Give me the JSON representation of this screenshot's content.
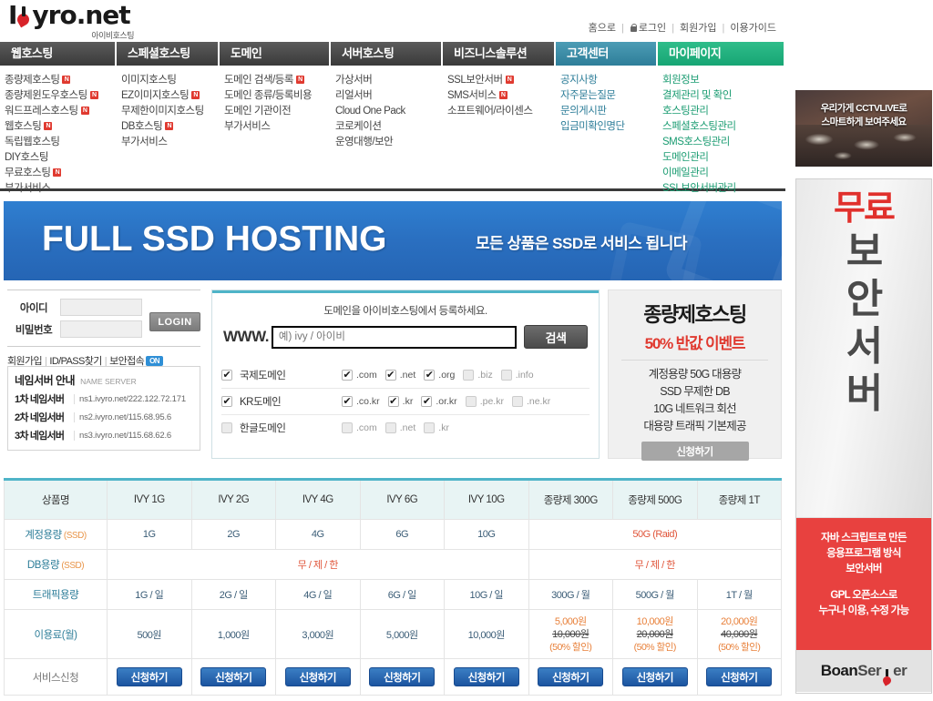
{
  "site": {
    "logo_text": "I",
    "logo_text2": "yro.net",
    "logo_sub": "아이비호스팅"
  },
  "top_links": [
    {
      "label": "홈으로",
      "icon": ""
    },
    {
      "label": "로그인",
      "icon": "lock-icon"
    },
    {
      "label": "회원가입",
      "icon": ""
    },
    {
      "label": "이용가이드",
      "icon": ""
    }
  ],
  "nav": {
    "tabs": [
      {
        "label": "웹호스팅",
        "style": "dark",
        "width": 128
      },
      {
        "label": "스페셜호스팅",
        "style": "dark",
        "width": 113
      },
      {
        "label": "도메인",
        "style": "dark",
        "width": 122
      },
      {
        "label": "서버호스팅",
        "style": "dark",
        "width": 123
      },
      {
        "label": "비즈니스솔루션",
        "style": "dark",
        "width": 124
      },
      {
        "label": "고객센터",
        "style": "cyan",
        "width": 112
      },
      {
        "label": "마이페이지",
        "style": "green",
        "width": 138
      }
    ]
  },
  "mega": {
    "columns": [
      {
        "style": "dark",
        "width": 128,
        "items": [
          {
            "label": "종량제호스팅",
            "new": true
          },
          {
            "label": "종량제윈도우호스팅",
            "new": true
          },
          {
            "label": "워드프레스호스팅",
            "new": true
          },
          {
            "label": "웹호스팅",
            "new": true
          },
          {
            "label": "독립웹호스팅",
            "new": false
          },
          {
            "label": "DIY호스팅",
            "new": false
          },
          {
            "label": "무료호스팅",
            "new": true
          },
          {
            "label": "부가서비스",
            "new": false
          }
        ]
      },
      {
        "style": "dark",
        "width": 113,
        "items": [
          {
            "label": "이미지호스팅",
            "new": false
          },
          {
            "label": "EZ이미지호스팅",
            "new": true
          },
          {
            "label": "무제한이미지호스팅",
            "new": false
          },
          {
            "label": "DB호스팅",
            "new": true
          },
          {
            "label": "부가서비스",
            "new": false
          }
        ]
      },
      {
        "style": "dark",
        "width": 122,
        "items": [
          {
            "label": "도메인 검색/등록",
            "new": true
          },
          {
            "label": "도메인 종류/등록비용",
            "new": false
          },
          {
            "label": "도메인 기관이전",
            "new": false
          },
          {
            "label": "부가서비스",
            "new": false
          }
        ]
      },
      {
        "style": "dark",
        "width": 123,
        "items": [
          {
            "label": "가상서버",
            "new": false
          },
          {
            "label": "리얼서버",
            "new": false
          },
          {
            "label": "Cloud One Pack",
            "new": false
          },
          {
            "label": "코로케이션",
            "new": false
          },
          {
            "label": "운영대행/보안",
            "new": false
          }
        ]
      },
      {
        "style": "dark",
        "width": 124,
        "items": [
          {
            "label": "SSL보안서버",
            "new": true
          },
          {
            "label": "SMS서비스",
            "new": true
          },
          {
            "label": "소프트웨어/라이센스",
            "new": false
          }
        ]
      },
      {
        "style": "cyan",
        "width": 112,
        "items": [
          {
            "label": "공지사항",
            "new": false
          },
          {
            "label": "자주묻는질문",
            "new": false
          },
          {
            "label": "문의게시판",
            "new": false
          },
          {
            "label": "입금미확인명단",
            "new": false
          }
        ]
      },
      {
        "style": "green",
        "width": 138,
        "items": [
          {
            "label": "회원정보",
            "new": false
          },
          {
            "label": "결제관리 및 확인",
            "new": false
          },
          {
            "label": "호스팅관리",
            "new": false
          },
          {
            "label": "스페셜호스팅관리",
            "new": false
          },
          {
            "label": "SMS호스팅관리",
            "new": false
          },
          {
            "label": "도메인관리",
            "new": false
          },
          {
            "label": "이메일관리",
            "new": false
          },
          {
            "label": "SSL보안서버관리",
            "new": false
          }
        ]
      }
    ]
  },
  "banner": {
    "title": "FULL SSD HOSTING",
    "subtitle": "모든 상품은 SSD로 서비스 됩니다",
    "bg_color": "#2a6fc0"
  },
  "login": {
    "id_label": "아이디",
    "id_value": "",
    "pw_label": "비밀번호",
    "pw_value": "",
    "button": "LOGIN",
    "links": [
      {
        "label": "회원가입"
      },
      {
        "label": "ID/PASS찾기"
      },
      {
        "label": "보안접속"
      }
    ],
    "secure_badge": "ON"
  },
  "nameserver": {
    "title": "네임서버 안내",
    "title_en": "NAME SERVER",
    "rows": [
      {
        "label": "1차 네임서버",
        "value": "ns1.ivyro.net/222.122.72.171"
      },
      {
        "label": "2차 네임서버",
        "value": "ns2.ivyro.net/115.68.95.6"
      },
      {
        "label": "3차 네임서버",
        "value": "ns3.ivyro.net/115.68.62.6"
      }
    ]
  },
  "domain_search": {
    "lead": "도메인을 아이비호스팅에서 등록하세요.",
    "www_prefix": "WWW.",
    "input_placeholder": "예) ivy / 아이비",
    "input_value": "",
    "search_button": "검색",
    "groups": [
      {
        "label": "국제도메인",
        "checked": true,
        "tlds": [
          {
            "label": ".com",
            "checked": true
          },
          {
            "label": ".net",
            "checked": true
          },
          {
            "label": ".org",
            "checked": true
          },
          {
            "label": ".biz",
            "checked": false
          },
          {
            "label": ".info",
            "checked": false
          }
        ]
      },
      {
        "label": "KR도메인",
        "checked": true,
        "tlds": [
          {
            "label": ".co.kr",
            "checked": true
          },
          {
            "label": ".kr",
            "checked": true
          },
          {
            "label": ".or.kr",
            "checked": true
          },
          {
            "label": ".pe.kr",
            "checked": false
          },
          {
            "label": ".ne.kr",
            "checked": false
          }
        ]
      },
      {
        "label": "한글도메인",
        "checked": false,
        "tlds": [
          {
            "label": ".com",
            "checked": false
          },
          {
            "label": ".net",
            "checked": false
          },
          {
            "label": ".kr",
            "checked": false
          }
        ]
      }
    ]
  },
  "promo": {
    "title": "종량제호스팅",
    "subtitle": "50% 반값 이벤트",
    "accent_color": "#e03a30",
    "lines": [
      "계정용량 50G 대용량",
      "SSD 무제한 DB",
      "10G 네트워크 회선",
      "대용량 트래픽 기본제공"
    ],
    "button": "신청하기"
  },
  "price_table": {
    "accent_color": "#4fb4c8",
    "headers": [
      "상품명",
      "IVY 1G",
      "IVY 2G",
      "IVY 4G",
      "IVY 6G",
      "IVY 10G",
      "종량제 300G",
      "종량제 500G",
      "종량제 1T"
    ],
    "rows": [
      {
        "label": "계정용량",
        "label_note": "(SSD)",
        "cells": [
          "1G",
          "2G",
          "4G",
          "6G",
          "10G"
        ],
        "merged": {
          "text": "50G (Raid)",
          "colspan": 3,
          "color": "red"
        }
      },
      {
        "label": "DB용량",
        "label_note": "(SSD)",
        "merged_left": {
          "text": "무 / 제 / 한",
          "colspan": 5,
          "color": "red"
        },
        "merged_right": {
          "text": "무 / 제 / 한",
          "colspan": 3,
          "color": "red"
        }
      },
      {
        "label": "트래픽용량",
        "label_note": "",
        "cells": [
          "1G / 일",
          "2G / 일",
          "4G / 일",
          "6G / 일",
          "10G / 일",
          "300G / 월",
          "500G / 월",
          "1T / 월"
        ]
      }
    ],
    "price_row": {
      "label": "이용료(월)",
      "simple": [
        "500원",
        "1,000원",
        "3,000원",
        "5,000원",
        "10,000원"
      ],
      "discounted": [
        {
          "new": "5,000원",
          "old": "10,000원",
          "note": "(50% 할인)"
        },
        {
          "new": "10,000원",
          "old": "20,000원",
          "note": "(50% 할인)"
        },
        {
          "new": "20,000원",
          "old": "40,000원",
          "note": "(50% 할인)"
        }
      ]
    },
    "apply_row": {
      "label": "서비스신청",
      "button_label": "신청하기",
      "count": 8
    }
  },
  "sidebar": {
    "ad_cctv": {
      "line1": "우리가게 CCTVLIVE로",
      "line2": "스마트하게 보여주세요"
    },
    "ad_boan": {
      "free_text": "무료",
      "vertical_word": [
        "보",
        "안",
        "서",
        "버"
      ],
      "red_lines_a": [
        "자바 스크립트로 만든",
        "응용프로그램 방식",
        "보안서버"
      ],
      "red_lines_b": [
        "GPL 오픈소스로",
        "누구나 이용, 수정 가능"
      ],
      "logo_a": "Boan",
      "logo_b": "Ser",
      "logo_c": "er",
      "red_color": "#e8413f"
    }
  }
}
